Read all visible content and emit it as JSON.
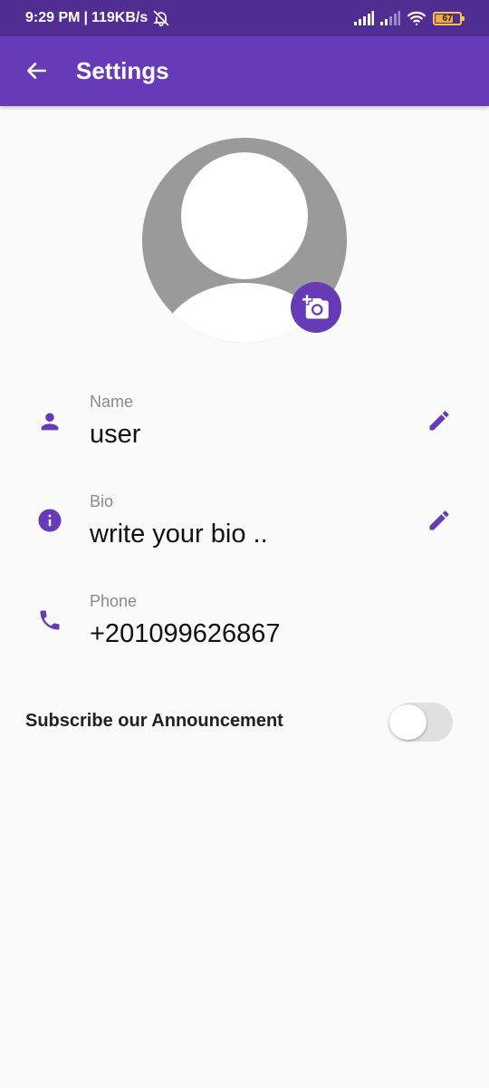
{
  "status_bar": {
    "time": "9:29 PM",
    "separator": "|",
    "speed": "119KB/s",
    "battery_level": "67",
    "icons": [
      "alarm-off-icon",
      "signal-icon",
      "signal-weak-icon",
      "wifi-icon",
      "battery-icon"
    ]
  },
  "app_bar": {
    "title": "Settings",
    "back_icon": "arrow-back-icon"
  },
  "profile": {
    "avatar_icon": "default-avatar-icon",
    "camera_icon": "add-a-photo-icon"
  },
  "fields": [
    {
      "label": "Name",
      "value": "user",
      "icon": "person-icon",
      "editable": true
    },
    {
      "label": "Bio",
      "value": "write your bio ..",
      "icon": "info-icon",
      "editable": true
    },
    {
      "label": "Phone",
      "value": "+201099626867",
      "icon": "phone-icon",
      "editable": false
    }
  ],
  "subscribe": {
    "label": "Subscribe our Announcement",
    "enabled": false
  },
  "colors": {
    "primary": "#673ab7",
    "status_bar": "#4f2d91",
    "background": "#fafafa",
    "avatar_grey": "#9a9a9a"
  }
}
